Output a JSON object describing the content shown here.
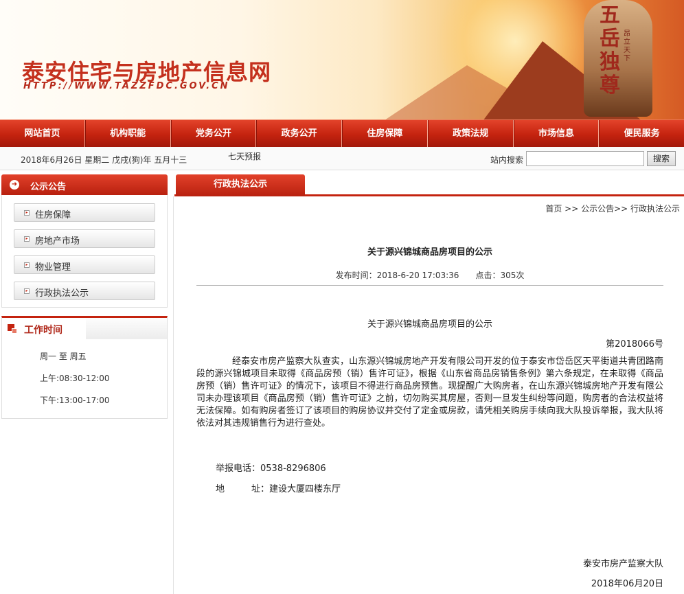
{
  "header": {
    "site_title": "泰安住宅与房地产信息网",
    "site_url": "HTTP://WWW.TAZZFDC.GOV.CN",
    "banner_text": "五岳独尊",
    "banner_small": "昂立天下"
  },
  "nav": {
    "items": [
      {
        "label": "网站首页"
      },
      {
        "label": "机构职能"
      },
      {
        "label": "党务公开"
      },
      {
        "label": "政务公开"
      },
      {
        "label": "住房保障"
      },
      {
        "label": "政策法规"
      },
      {
        "label": "市场信息"
      },
      {
        "label": "便民服务"
      }
    ]
  },
  "infobar": {
    "date": "2018年6月26日 星期二 戊戌(狗)年 五月十三",
    "forecast": "七天预报",
    "search_label": "站内搜索",
    "search_placeholder": "",
    "search_button": "搜索"
  },
  "sidebar": {
    "notice_title": "公示公告",
    "links": [
      {
        "label": "住房保障"
      },
      {
        "label": "房地产市场"
      },
      {
        "label": "物业管理"
      },
      {
        "label": "行政执法公示"
      }
    ],
    "hours_title": "工作时间",
    "hours": [
      "周一 至 周五",
      "上午:08:30-12:00",
      "下午:13:00-17:00"
    ]
  },
  "main": {
    "tab_label": "行政执法公示",
    "breadcrumb": "首页 >> 公示公告>> 行政执法公示",
    "article_title": "关于源兴锦城商品房项目的公示",
    "publish_time": "发布时间：2018-6-20 17:03:36",
    "clicks": "点击：305次",
    "content_title": "关于源兴锦城商品房项目的公示",
    "doc_number": "第2018066号",
    "body": "经泰安市房产监察大队查实，山东源兴锦城房地产开发有限公司开发的位于泰安市岱岳区天平街道共青团路南段的源兴锦城项目未取得《商品房预（销）售许可证》，根据《山东省商品房销售条例》第六条规定，在未取得《商品房预（销）售许可证》的情况下，该项目不得进行商品房预售。现提醒广大购房者，在山东源兴锦城房地产开发有限公司未办理该项目《商品房预（销）售许可证》之前，切勿购买其房屋，否则一旦发生纠纷等问题，购房者的合法权益将无法保障。如有购房者签订了该项目的购房协议并交付了定金或房款，请凭相关购房手续向我大队投诉举报，我大队将依法对其违规销售行为进行查处。",
    "phone": "举报电话：0538-8296806",
    "address": "地　　　址：建设大厦四楼东厅",
    "signature": "泰安市房产监察大队",
    "sign_date": "2018年06月20日"
  }
}
